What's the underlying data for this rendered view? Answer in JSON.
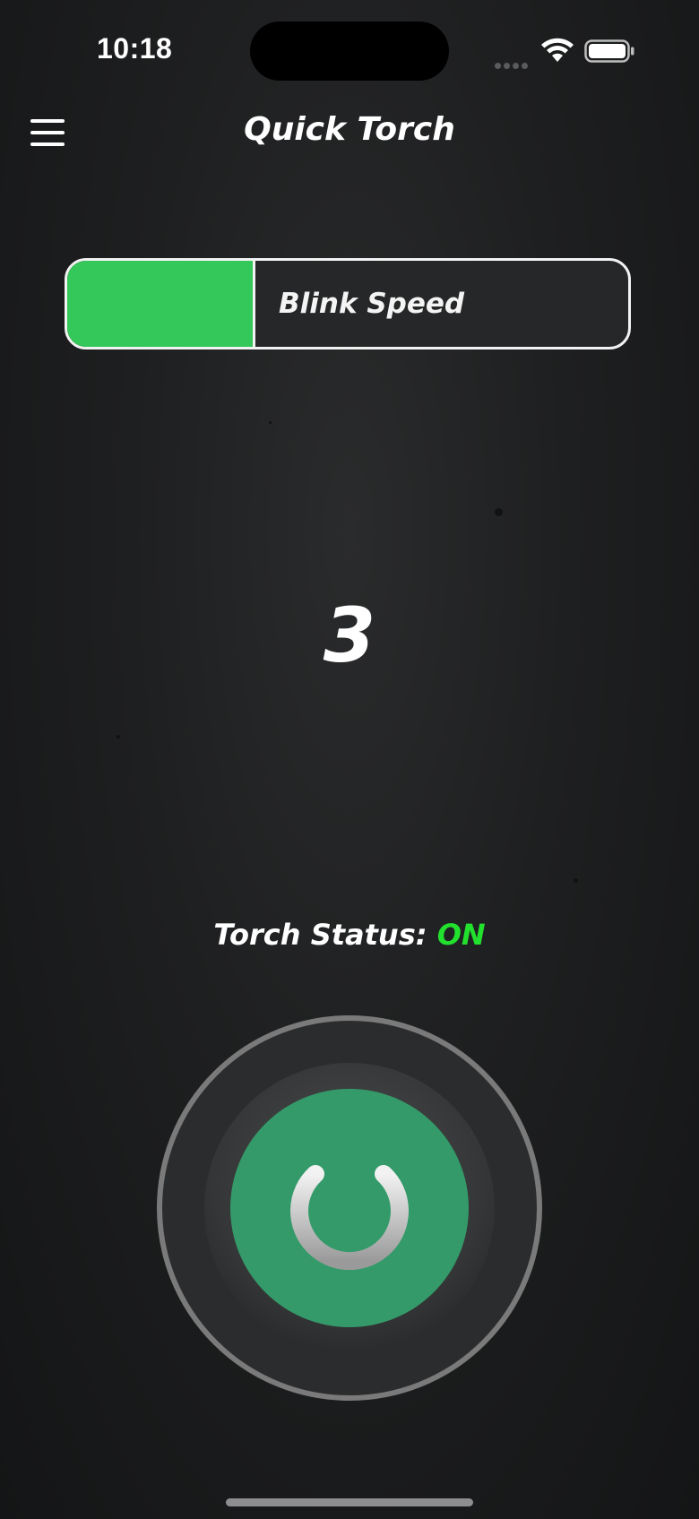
{
  "status_bar": {
    "time": "10:18"
  },
  "header": {
    "title": "Quick Torch",
    "menu_icon": "hamburger-menu-icon"
  },
  "blink_speed": {
    "label": "Blink Speed",
    "level_fraction": 0.33,
    "fill_color": "#34c759"
  },
  "speed_display": {
    "value": "3"
  },
  "torch_status": {
    "label": "Torch Status:",
    "value": "ON",
    "value_color": "#22e02e"
  },
  "power_button": {
    "icon": "power-icon",
    "core_color": "#349a69"
  }
}
